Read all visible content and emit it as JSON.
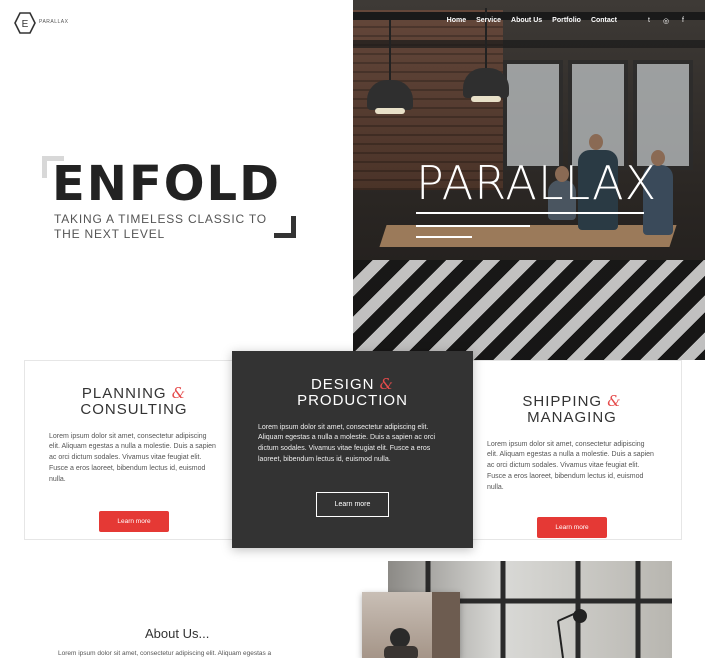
{
  "header": {
    "logo_letter": "E",
    "logo_text": "PARALLAX",
    "nav": [
      "Home",
      "Service",
      "About Us",
      "Portfolio",
      "Contact"
    ],
    "social_icons": [
      "twitter-icon",
      "dribbble-icon",
      "facebook-icon"
    ],
    "social_glyphs": [
      "t",
      "◎",
      "f"
    ]
  },
  "hero": {
    "title": "ENFOLD",
    "subtitle": "TAKING A TIMELESS CLASSIC TO THE NEXT LEVEL",
    "parallax_title": "PARALLAX"
  },
  "cards": [
    {
      "title_a": "PLANNING",
      "amp": "&",
      "title_b": "CONSULTING",
      "text": "Lorem ipsum dolor sit amet, consectetur adipiscing elit. Aliquam egestas a nulla a molestie. Duis a sapien ac orci dictum sodales. Vivamus vitae feugiat elit. Fusce a eros laoreet, bibendum lectus id, euismod nulla.",
      "button": "Learn more"
    },
    {
      "title_a": "DESIGN",
      "amp": "&",
      "title_b": "PRODUCTION",
      "text": "Lorem ipsum dolor sit amet, consectetur adipiscing elit. Aliquam egestas a nulla a molestie. Duis a sapien ac orci dictum sodales. Vivamus vitae feugiat elit. Fusce a eros laoreet, bibendum lectus id, euismod nulla.",
      "button": "Learn more"
    },
    {
      "title_a": "SHIPPING",
      "amp": "&",
      "title_b": "MANAGING",
      "text": "Lorem ipsum dolor sit amet, consectetur adipiscing elit. Aliquam egestas a nulla a molestie. Duis a sapien ac orci dictum sodales. Vivamus vitae feugiat elit. Fusce a eros laoreet, bibendum lectus id, euismod nulla.",
      "button": "Learn more"
    }
  ],
  "about": {
    "title": "About Us...",
    "text": "Lorem ipsum dolor sit amet, consectetur adipiscing elit. Aliquam egestas a"
  },
  "colors": {
    "accent": "#e53935",
    "dark_card": "#333333",
    "text": "#333333"
  }
}
